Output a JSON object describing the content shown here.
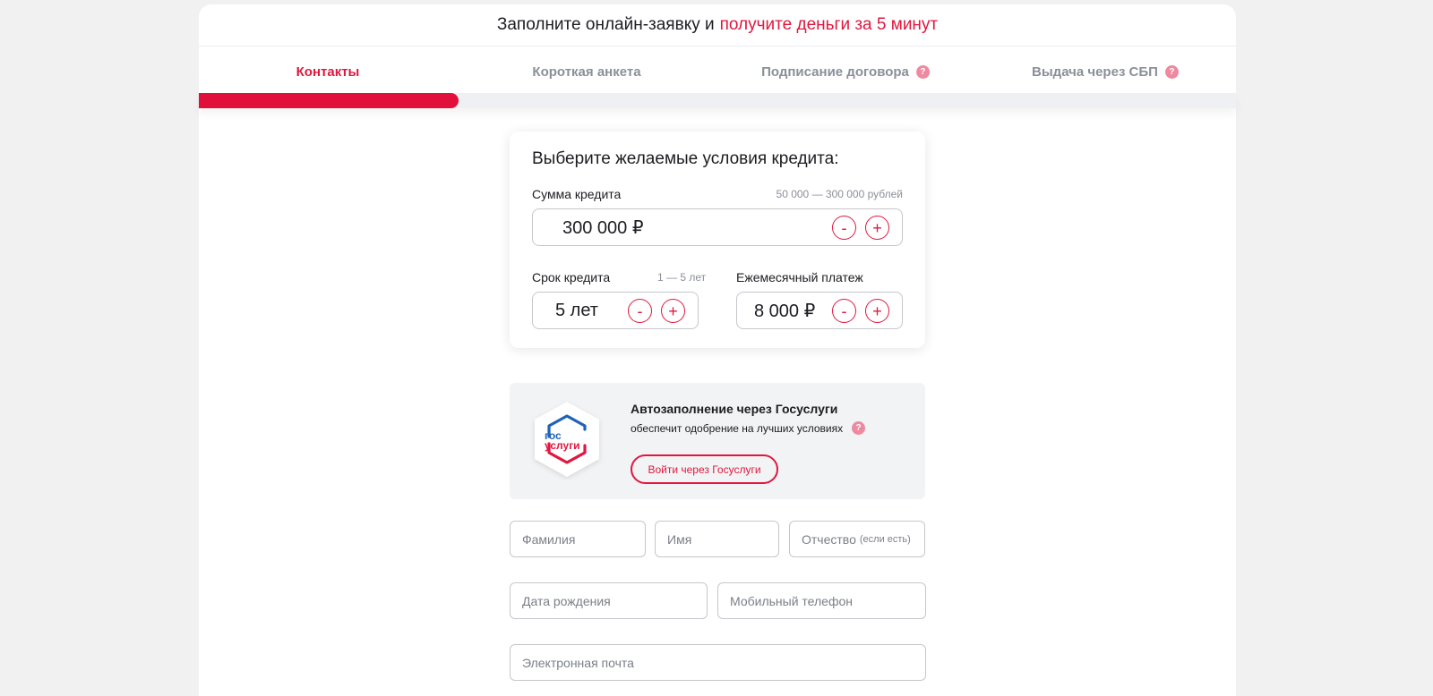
{
  "header": {
    "headline_prefix": "Заполните онлайн-заявку и",
    "headline_accent": "получите деньги за 5 минут"
  },
  "steps": [
    {
      "label": "Контакты",
      "active": true
    },
    {
      "label": "Короткая анкета",
      "active": false
    },
    {
      "label": "Подписание договора",
      "active": false,
      "help": "?"
    },
    {
      "label": "Выдача через СБП",
      "active": false,
      "help": "?"
    }
  ],
  "progress": {
    "completed_fraction": 0.25
  },
  "loan": {
    "title": "Выберите желаемые условия кредита:",
    "amount_label": "Сумма кредита",
    "amount_range": "50 000 — 300 000 рублей",
    "amount_value": "300 000  ₽",
    "term_label": "Срок кредита",
    "term_range": "1 — 5 лет",
    "term_value": "5  лет",
    "payment_label": "Ежемесячный платеж",
    "payment_value": "8 000  ₽",
    "minus": "-",
    "plus": "+"
  },
  "gosuslugi": {
    "logo_line1": "гос",
    "logo_line2": "услуги",
    "title": "Автозаполнение через Госуслуги",
    "subtitle": "обеспечит одобрение на лучших условиях",
    "help": "?",
    "button": "Войти через Госуслуги"
  },
  "form": {
    "last_name": "Фамилия",
    "first_name": "Имя",
    "middle_name": "Отчество",
    "middle_name_note": "(если есть)",
    "birth_date": "Дата рождения",
    "phone": "Мобильный телефон",
    "email": "Электронная почта"
  },
  "colors": {
    "accent": "#e0173e",
    "muted": "#8b8f99",
    "background": "#f1f1f2"
  }
}
